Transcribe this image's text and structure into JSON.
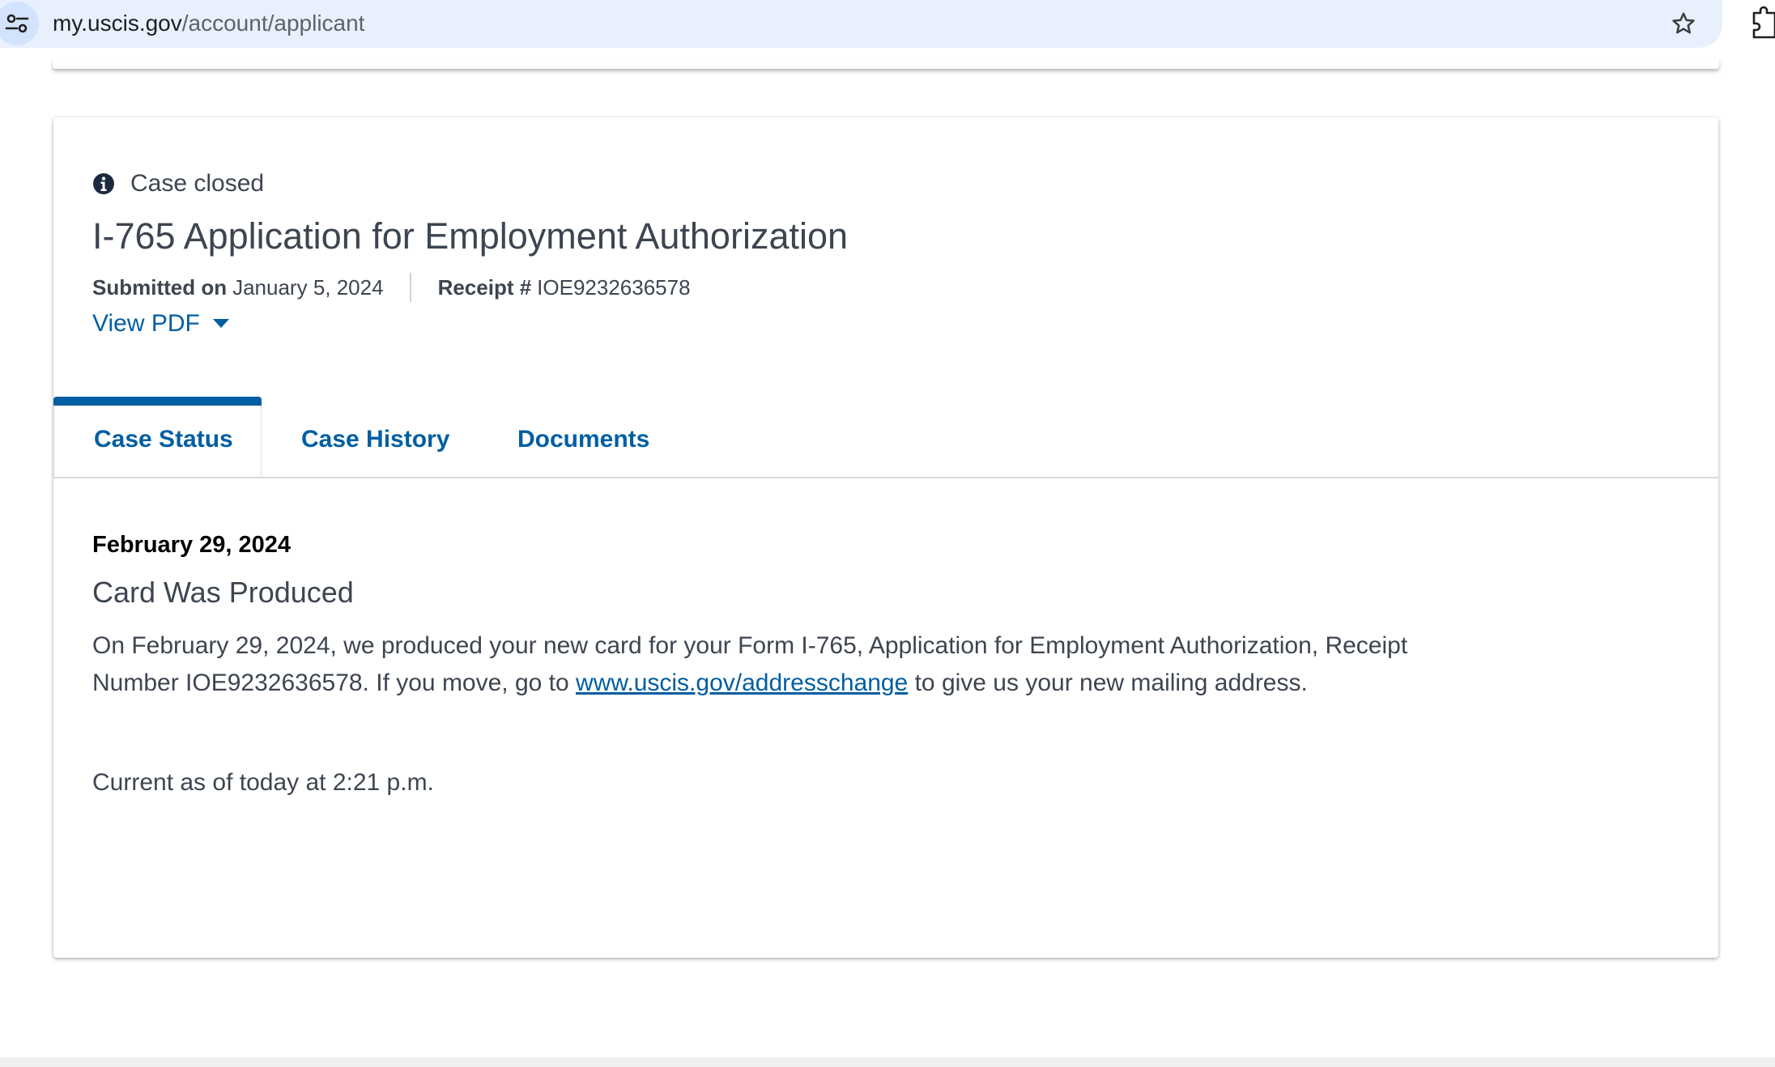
{
  "browser": {
    "url_host": "my.uscis.gov",
    "url_path": "/account/applicant",
    "icons": {
      "site_info": "tune-icon",
      "bookmark": "star-outline-icon",
      "extensions": "extension-icon"
    }
  },
  "case": {
    "status_icon": "info-icon",
    "status_text": "Case closed",
    "title": "I-765 Application for Employment Authorization",
    "submitted_label": "Submitted on",
    "submitted_date": "January 5, 2024",
    "receipt_label": "Receipt #",
    "receipt_number": "IOE9232636578",
    "view_pdf_label": "View PDF"
  },
  "tabs": [
    {
      "label": "Case Status",
      "active": true
    },
    {
      "label": "Case History",
      "active": false
    },
    {
      "label": "Documents",
      "active": false
    }
  ],
  "status_update": {
    "date": "February 29, 2024",
    "heading": "Card Was Produced",
    "body_before_link": "On February 29, 2024, we produced your new card for your Form I-765, Application for Employment Authorization, Receipt Number IOE9232636578. If you move, go to ",
    "link_text": "www.uscis.gov/addresschange",
    "body_after_link": " to give us your new mailing address.",
    "current_as_of": "Current as of today at 2:21 p.m."
  },
  "colors": {
    "link_blue": "#005ea2",
    "text_dark": "#3d4551",
    "omnibox_bg": "#e8f0fe"
  }
}
